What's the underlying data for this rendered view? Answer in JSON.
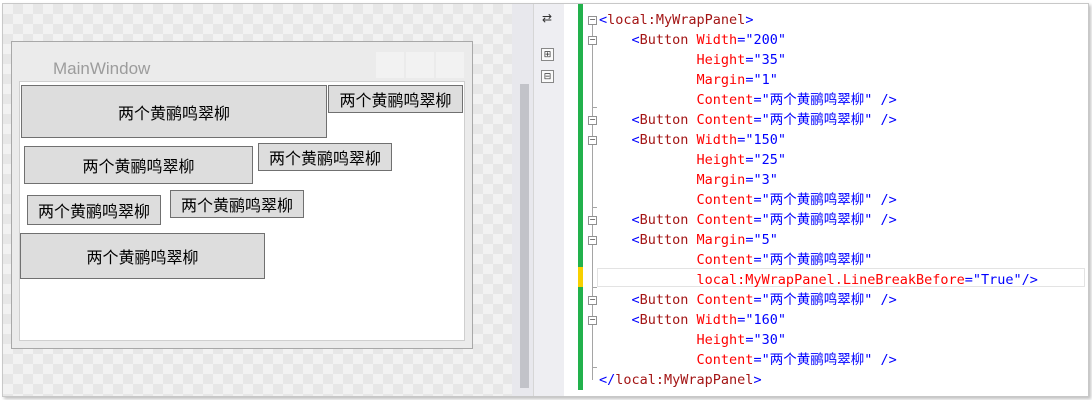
{
  "designer": {
    "window_title": "MainWindow",
    "buttons": [
      {
        "label": "两个黄鹂鸣翠柳"
      },
      {
        "label": "两个黄鹂鸣翠柳"
      },
      {
        "label": "两个黄鹂鸣翠柳"
      },
      {
        "label": "两个黄鹂鸣翠柳"
      },
      {
        "label": "两个黄鹂鸣翠柳"
      },
      {
        "label": "两个黄鹂鸣翠柳"
      },
      {
        "label": "两个黄鹂鸣翠柳"
      }
    ]
  },
  "toolbar": {
    "swap_icon": "⇄",
    "expand_icon": "⊞",
    "collapse_icon": "⊟"
  },
  "colors": {
    "change_bar": "#22b14c",
    "unsaved_bar": "#f7d000",
    "xml_tag": "#a31515",
    "xml_attr": "#ff0000",
    "xml_value": "#0000ff"
  },
  "code": {
    "lines": [
      {
        "parts": [
          {
            "t": "<",
            "c": "blue"
          },
          {
            "t": "local:MyWrapPanel",
            "c": "maroon"
          },
          {
            "t": ">",
            "c": "blue"
          }
        ]
      },
      {
        "parts": [
          {
            "t": "    <",
            "c": "blue"
          },
          {
            "t": "Button",
            "c": "maroon"
          },
          {
            "t": " Width",
            "c": "red"
          },
          {
            "t": "=",
            "c": "blue"
          },
          {
            "t": "\"200\"",
            "c": "blue"
          }
        ]
      },
      {
        "parts": [
          {
            "t": "            Height",
            "c": "red"
          },
          {
            "t": "=",
            "c": "blue"
          },
          {
            "t": "\"35\"",
            "c": "blue"
          }
        ]
      },
      {
        "parts": [
          {
            "t": "            Margin",
            "c": "red"
          },
          {
            "t": "=",
            "c": "blue"
          },
          {
            "t": "\"1\"",
            "c": "blue"
          }
        ]
      },
      {
        "parts": [
          {
            "t": "            Content",
            "c": "red"
          },
          {
            "t": "=",
            "c": "blue"
          },
          {
            "t": "\"两个黄鹂鸣翠柳\"",
            "c": "blue"
          },
          {
            "t": " />",
            "c": "blue"
          }
        ]
      },
      {
        "parts": [
          {
            "t": "    <",
            "c": "blue"
          },
          {
            "t": "Button",
            "c": "maroon"
          },
          {
            "t": " Content",
            "c": "red"
          },
          {
            "t": "=",
            "c": "blue"
          },
          {
            "t": "\"两个黄鹂鸣翠柳\"",
            "c": "blue"
          },
          {
            "t": " />",
            "c": "blue"
          }
        ]
      },
      {
        "parts": [
          {
            "t": "    <",
            "c": "blue"
          },
          {
            "t": "Button",
            "c": "maroon"
          },
          {
            "t": " Width",
            "c": "red"
          },
          {
            "t": "=",
            "c": "blue"
          },
          {
            "t": "\"150\"",
            "c": "blue"
          }
        ]
      },
      {
        "parts": [
          {
            "t": "            Height",
            "c": "red"
          },
          {
            "t": "=",
            "c": "blue"
          },
          {
            "t": "\"25\"",
            "c": "blue"
          }
        ]
      },
      {
        "parts": [
          {
            "t": "            Margin",
            "c": "red"
          },
          {
            "t": "=",
            "c": "blue"
          },
          {
            "t": "\"3\"",
            "c": "blue"
          }
        ]
      },
      {
        "parts": [
          {
            "t": "            Content",
            "c": "red"
          },
          {
            "t": "=",
            "c": "blue"
          },
          {
            "t": "\"两个黄鹂鸣翠柳\"",
            "c": "blue"
          },
          {
            "t": " />",
            "c": "blue"
          }
        ]
      },
      {
        "parts": [
          {
            "t": "    <",
            "c": "blue"
          },
          {
            "t": "Button",
            "c": "maroon"
          },
          {
            "t": " Content",
            "c": "red"
          },
          {
            "t": "=",
            "c": "blue"
          },
          {
            "t": "\"两个黄鹂鸣翠柳\"",
            "c": "blue"
          },
          {
            "t": " />",
            "c": "blue"
          }
        ]
      },
      {
        "parts": [
          {
            "t": "    <",
            "c": "blue"
          },
          {
            "t": "Button",
            "c": "maroon"
          },
          {
            "t": " Margin",
            "c": "red"
          },
          {
            "t": "=",
            "c": "blue"
          },
          {
            "t": "\"5\"",
            "c": "blue"
          }
        ]
      },
      {
        "parts": [
          {
            "t": "            Content",
            "c": "red"
          },
          {
            "t": "=",
            "c": "blue"
          },
          {
            "t": "\"两个黄鹂鸣翠柳\"",
            "c": "blue"
          }
        ]
      },
      {
        "parts": [
          {
            "t": "            local:MyWrapPanel.LineBreakBefore",
            "c": "red"
          },
          {
            "t": "=",
            "c": "blue"
          },
          {
            "t": "\"True\"",
            "c": "blue"
          },
          {
            "t": "/>",
            "c": "blue"
          }
        ]
      },
      {
        "parts": [
          {
            "t": "    <",
            "c": "blue"
          },
          {
            "t": "Button",
            "c": "maroon"
          },
          {
            "t": " Content",
            "c": "red"
          },
          {
            "t": "=",
            "c": "blue"
          },
          {
            "t": "\"两个黄鹂鸣翠柳\"",
            "c": "blue"
          },
          {
            "t": " />",
            "c": "blue"
          }
        ]
      },
      {
        "parts": [
          {
            "t": "    <",
            "c": "blue"
          },
          {
            "t": "Button",
            "c": "maroon"
          },
          {
            "t": " Width",
            "c": "red"
          },
          {
            "t": "=",
            "c": "blue"
          },
          {
            "t": "\"160\"",
            "c": "blue"
          }
        ]
      },
      {
        "parts": [
          {
            "t": "            Height",
            "c": "red"
          },
          {
            "t": "=",
            "c": "blue"
          },
          {
            "t": "\"30\"",
            "c": "blue"
          }
        ]
      },
      {
        "parts": [
          {
            "t": "            Content",
            "c": "red"
          },
          {
            "t": "=",
            "c": "blue"
          },
          {
            "t": "\"两个黄鹂鸣翠柳\"",
            "c": "blue"
          },
          {
            "t": " />",
            "c": "blue"
          }
        ]
      },
      {
        "parts": [
          {
            "t": "</",
            "c": "blue"
          },
          {
            "t": "local:MyWrapPanel",
            "c": "maroon"
          },
          {
            "t": ">",
            "c": "blue"
          }
        ]
      }
    ]
  }
}
